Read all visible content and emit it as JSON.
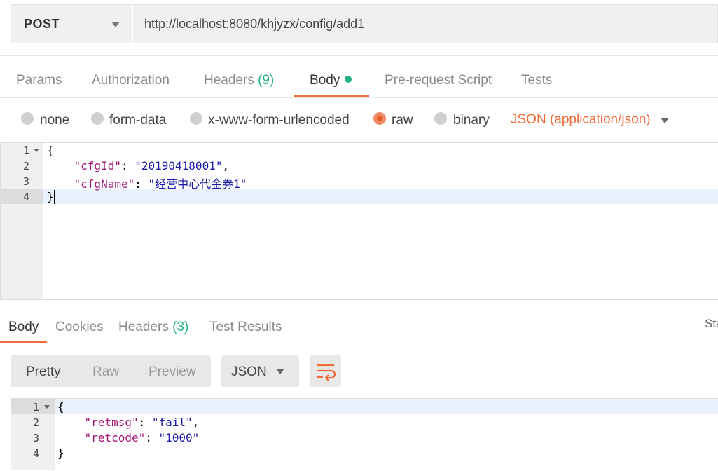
{
  "request": {
    "method": "POST",
    "url": "http://localhost:8080/khjyzx/config/add1"
  },
  "request_tabs": [
    {
      "label": "Params"
    },
    {
      "label": "Authorization"
    },
    {
      "label": "Headers",
      "count": "(9)"
    },
    {
      "label": "Body",
      "active": true
    },
    {
      "label": "Pre-request Script"
    },
    {
      "label": "Tests"
    }
  ],
  "body_types": {
    "none": "none",
    "form_data": "form-data",
    "urlencoded": "x-www-form-urlencoded",
    "raw": "raw",
    "binary": "binary",
    "selected": "raw",
    "format": "JSON (application/json)"
  },
  "request_editor": {
    "line_numbers": [
      "1",
      "2",
      "3",
      "4"
    ],
    "lines": [
      {
        "plain": "{"
      },
      {
        "key": "\"cfgId\"",
        "sep": ": ",
        "value": "\"20190418001\"",
        "trail": ","
      },
      {
        "key": "\"cfgName\"",
        "sep": ": ",
        "value": "\"经营中心代金券1\"",
        "trail": ""
      },
      {
        "plain": "}"
      }
    ],
    "active_line": "4"
  },
  "response_tabs": [
    {
      "label": "Body",
      "active": true
    },
    {
      "label": "Cookies"
    },
    {
      "label": "Headers",
      "count": "(3)"
    },
    {
      "label": "Test Results"
    }
  ],
  "response_status_partial": "Sta",
  "view_modes": {
    "pretty": "Pretty",
    "raw": "Raw",
    "preview": "Preview",
    "active": "Pretty"
  },
  "response_format": "JSON",
  "response_editor": {
    "line_numbers": [
      "1",
      "2",
      "3",
      "4"
    ],
    "lines": [
      {
        "plain": "{"
      },
      {
        "key": "\"retmsg\"",
        "sep": ": ",
        "value": "\"fail\"",
        "trail": ","
      },
      {
        "key": "\"retcode\"",
        "sep": ": ",
        "value": "\"1000\"",
        "trail": ""
      },
      {
        "plain": "}"
      }
    ],
    "active_line": "1"
  },
  "colors": {
    "accent": "#f26b3a",
    "count_green": "#26b47f",
    "json_key": "#a31576",
    "json_string": "#1a1aa6"
  }
}
